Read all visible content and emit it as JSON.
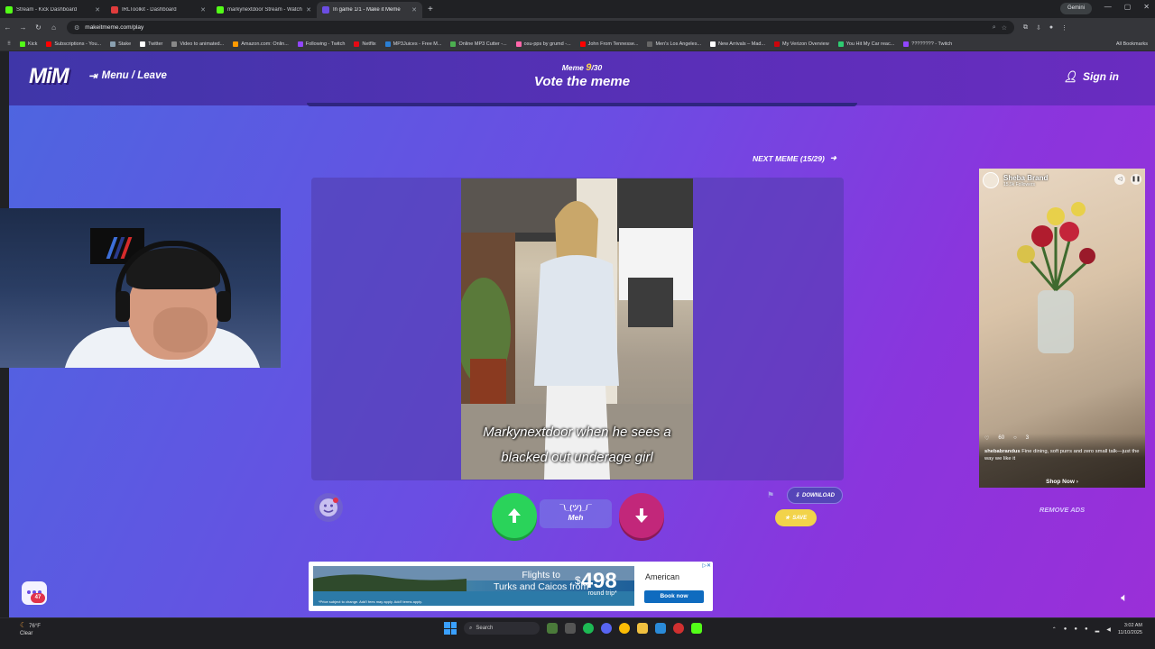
{
  "browser": {
    "tabs": [
      {
        "label": "Stream - Kick Dashboard",
        "color": "#53fc18",
        "active": false
      },
      {
        "label": "IRLToolkit - Dashboard",
        "color": "#e03c3c",
        "active": false
      },
      {
        "label": "markynextdoor Stream - Watch",
        "color": "#53fc18",
        "active": false
      },
      {
        "label": "In game 1/1 - Make it Meme",
        "color": "#6b4de3",
        "active": true
      }
    ],
    "gemini_label": "Gemini",
    "url": "makeitmeme.com/play",
    "bookmarks": [
      {
        "label": "Kick",
        "color": "#53fc18"
      },
      {
        "label": "Subscriptions - You...",
        "color": "#ff0000"
      },
      {
        "label": "Stake",
        "color": "#1a2c38"
      },
      {
        "label": "Twitter",
        "color": "#ffffff"
      },
      {
        "label": "Video to animated...",
        "color": "#888888"
      },
      {
        "label": "Amazon.com: Onlin...",
        "color": "#ff9900"
      },
      {
        "label": "Following - Twitch",
        "color": "#9146ff"
      },
      {
        "label": "Netflix",
        "color": "#e50914"
      },
      {
        "label": "MP3Juices - Free M...",
        "color": "#2a7fd4"
      },
      {
        "label": "Online MP3 Cutter -...",
        "color": "#4caf50"
      },
      {
        "label": "osu-pps by grumd -...",
        "color": "#ff66aa"
      },
      {
        "label": "John From Tennesse...",
        "color": "#ff0000"
      },
      {
        "label": "Men's Los Angeles...",
        "color": "#333333"
      },
      {
        "label": "New Arrivals – Mad...",
        "color": "#ffffff"
      },
      {
        "label": "My Verizon Overview",
        "color": "#cd040b"
      },
      {
        "label": "You Hit My Car reac...",
        "color": "#2ecc71"
      },
      {
        "label": "???????? - Twitch",
        "color": "#9146ff"
      }
    ],
    "all_bookmarks_label": "All Bookmarks"
  },
  "header": {
    "logo": "MiM",
    "menu_leave": "Menu / Leave",
    "meme_prefix": "Meme",
    "meme_number": "9",
    "meme_total": "/30",
    "title": "Vote the meme",
    "sign_in": "Sign in"
  },
  "meme": {
    "next_meme_label": "NEXT MEME (15/29)",
    "caption_line1": "Markynextdoor when he sees a",
    "caption_line2": "blacked out underage girl"
  },
  "vote": {
    "meh_face": "¯\\_(ツ)_/¯",
    "meh_label": "Meh",
    "download_label": "DOWNLOAD",
    "save_label": "SAVE"
  },
  "side_ad": {
    "brand": "Sheba Brand",
    "followers": "15.9k Followers",
    "likes": "60",
    "comments": "3",
    "handle": "shebabrandus",
    "description": "Fine dining, soft purrs and zero small talk—just the way we like it",
    "shop_now": "Shop Now",
    "remove_ads": "REMOVE ADS"
  },
  "bottom_ad": {
    "flights_line1": "Flights to",
    "flights_line2": "Turks and Caicos from",
    "dollar": "$",
    "price": "498",
    "round_trip": "round trip*",
    "fine_print": "*Price subject to change. Add'l fees may apply. Add'l terms apply.",
    "airline": "American",
    "book_now": "Book now"
  },
  "chat_badge": "47",
  "taskbar": {
    "temp": "76°F",
    "condition": "Clear",
    "search": "Search",
    "time": "3:02 AM",
    "date": "11/10/2025"
  }
}
